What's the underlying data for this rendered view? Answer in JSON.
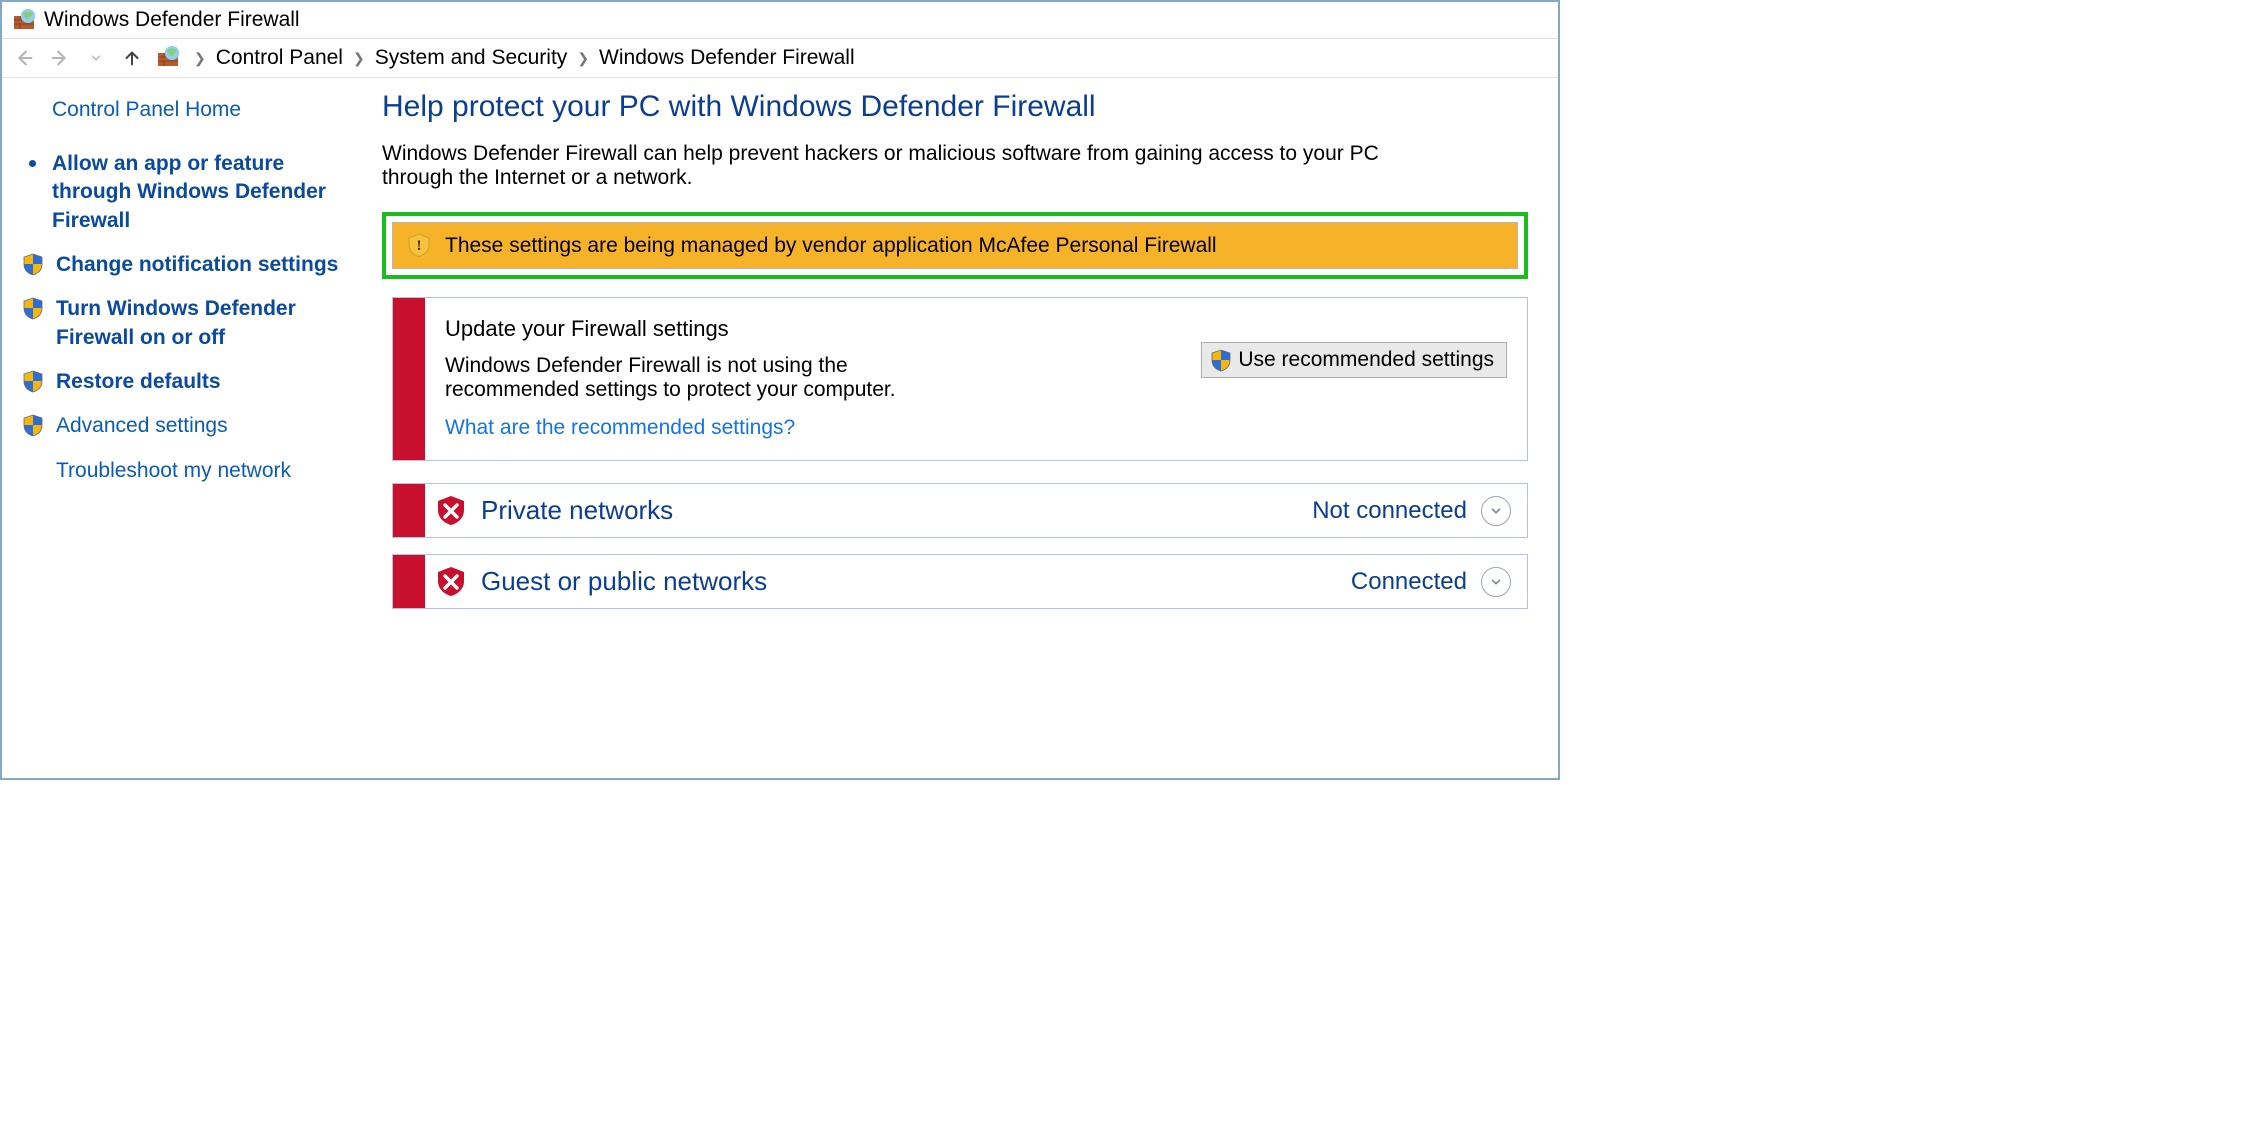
{
  "window": {
    "title": "Windows Defender Firewall"
  },
  "breadcrumb": [
    "Control Panel",
    "System and Security",
    "Windows Defender Firewall"
  ],
  "sidebar": {
    "home": "Control Panel Home",
    "items": [
      {
        "label": "Allow an app or feature through Windows Defender Firewall",
        "icon": "bullet",
        "bold": true
      },
      {
        "label": "Change notification settings",
        "icon": "shield",
        "bold": true
      },
      {
        "label": "Turn Windows Defender Firewall on or off",
        "icon": "shield",
        "bold": true
      },
      {
        "label": "Restore defaults",
        "icon": "shield",
        "bold": true
      },
      {
        "label": "Advanced settings",
        "icon": "shield",
        "bold": false
      },
      {
        "label": "Troubleshoot my network",
        "icon": "none",
        "bold": false
      }
    ]
  },
  "main": {
    "heading": "Help protect your PC with Windows Defender Firewall",
    "description": "Windows Defender Firewall can help prevent hackers or malicious software from gaining access to your PC through the Internet or a network.",
    "banner": "These settings are being managed by vendor application McAfee Personal Firewall",
    "update": {
      "title": "Update your Firewall settings",
      "desc": "Windows Defender Firewall is not using the recommended settings to protect your computer.",
      "link": "What are the recommended settings?",
      "button": "Use recommended settings"
    },
    "networks": [
      {
        "name": "Private networks",
        "status": "Not connected"
      },
      {
        "name": "Guest or public networks",
        "status": "Connected"
      }
    ]
  }
}
